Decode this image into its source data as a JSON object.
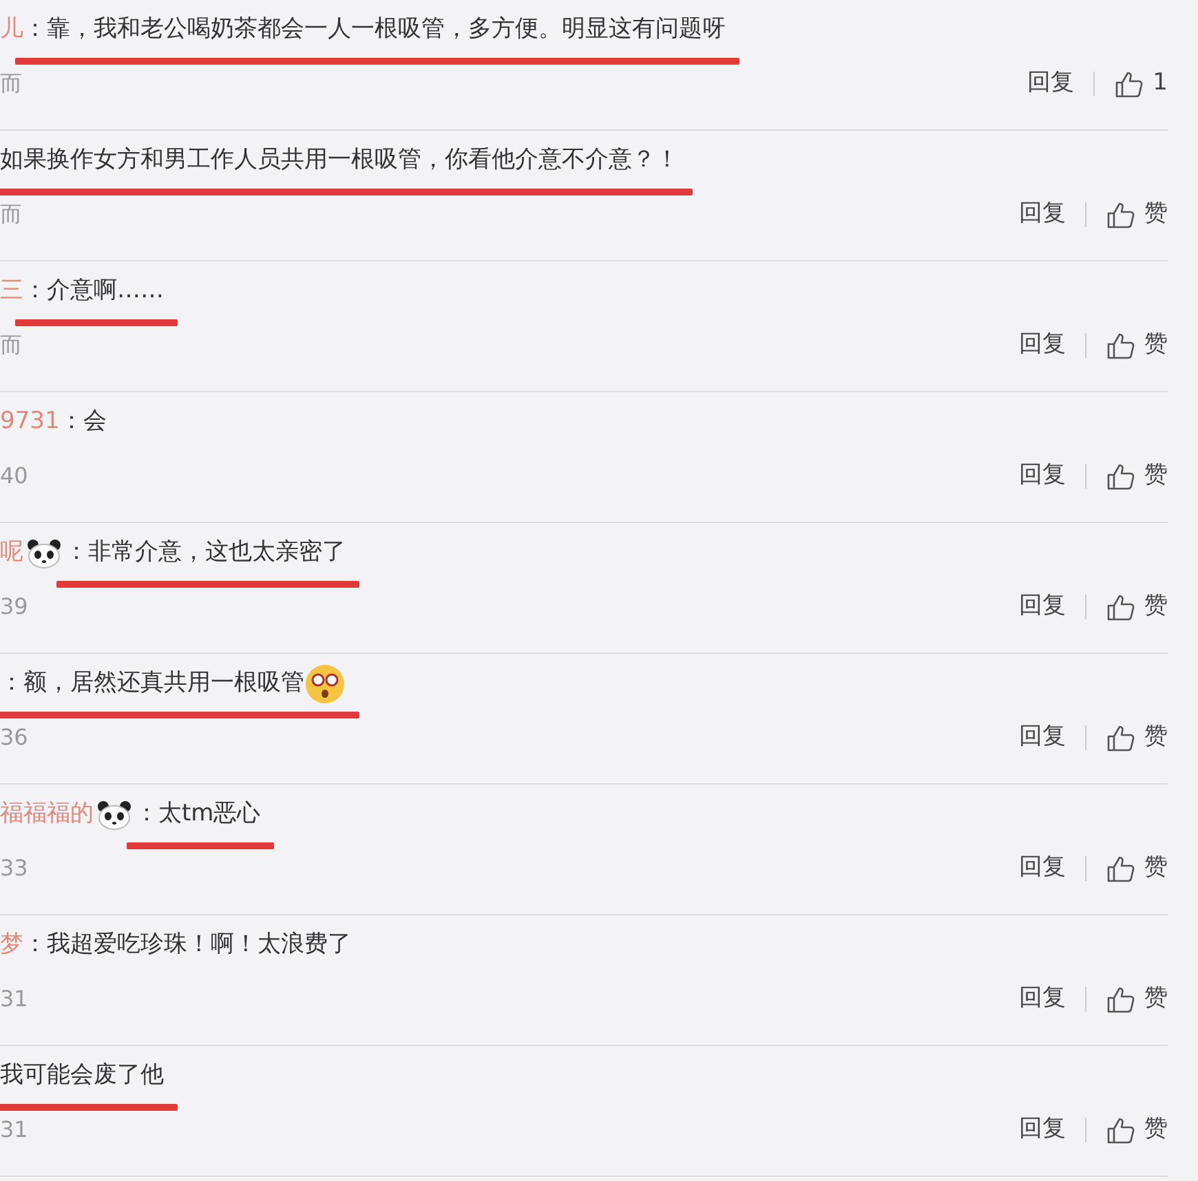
{
  "comments": [
    {
      "user": "儿",
      "text": "：靠，我和老公喝奶茶都会一人一根吸管，多方便。明显这有问题呀",
      "underlined": true,
      "time": "而",
      "reply": "回复",
      "like": "1"
    },
    {
      "text": "如果换作女方和男工作人员共用一根吸管，你看他介意不介意？！",
      "underlined": true,
      "time": "而",
      "reply": "回复",
      "like": "赞"
    },
    {
      "user": "三",
      "text": "：介意啊……",
      "underlined": true,
      "time": "而",
      "reply": "回复",
      "like": "赞"
    },
    {
      "user": "9731",
      "text": "：会",
      "underlined": false,
      "time": "40",
      "reply": "回复",
      "like": "赞"
    },
    {
      "user": "呢",
      "user_icon": {
        "kind": "panda"
      },
      "text": "：非常介意，这也太亲密了",
      "underlined": true,
      "time": "39",
      "reply": "回复",
      "like": "赞"
    },
    {
      "text": "：额，居然还真共用一根吸管",
      "text_icon": {
        "kind": "shocked"
      },
      "underlined": true,
      "time": "36",
      "reply": "回复",
      "like": "赞"
    },
    {
      "user": "福福福的",
      "user_icon": {
        "kind": "panda"
      },
      "text": "：太tm恶心",
      "underlined": true,
      "time": "33",
      "reply": "回复",
      "like": "赞"
    },
    {
      "user": "梦",
      "text": "：我超爱吃珍珠！啊！太浪费了",
      "underlined": false,
      "time": "31",
      "reply": "回复",
      "like": "赞"
    },
    {
      "text": "我可能会废了他",
      "underlined": true,
      "time": "31",
      "reply": "回复",
      "like": "赞"
    }
  ]
}
